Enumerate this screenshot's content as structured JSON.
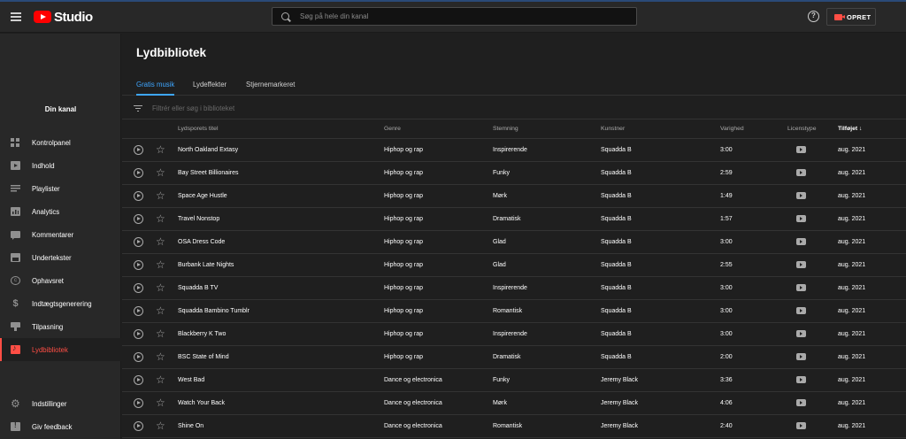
{
  "header": {
    "logo_text": "Studio",
    "search_placeholder": "Søg på hele din kanal",
    "help_symbol": "?",
    "create_label": "OPRET"
  },
  "sidebar": {
    "channel_label": "Din kanal",
    "items": [
      {
        "label": "Kontrolpanel",
        "icon": "dashboard-icon"
      },
      {
        "label": "Indhold",
        "icon": "content-icon"
      },
      {
        "label": "Playlister",
        "icon": "playlist-icon"
      },
      {
        "label": "Analytics",
        "icon": "analytics-icon"
      },
      {
        "label": "Kommentarer",
        "icon": "comments-icon"
      },
      {
        "label": "Undertekster",
        "icon": "subtitles-icon"
      },
      {
        "label": "Ophavsret",
        "icon": "copyright-icon"
      },
      {
        "label": "Indtægtsgenerering",
        "icon": "dollar-icon"
      },
      {
        "label": "Tilpasning",
        "icon": "customization-icon"
      },
      {
        "label": "Lydbibliotek",
        "icon": "audio-library-icon",
        "active": true
      }
    ],
    "bottom_items": [
      {
        "label": "Indstillinger",
        "icon": "settings-icon"
      },
      {
        "label": "Giv feedback",
        "icon": "feedback-icon"
      }
    ]
  },
  "main": {
    "title": "Lydbibliotek",
    "tabs": [
      {
        "label": "Gratis musik",
        "active": true
      },
      {
        "label": "Lydeffekter"
      },
      {
        "label": "Stjernemarkeret"
      }
    ],
    "filter_placeholder": "Filtrér eller søg i biblioteket",
    "columns": {
      "title": "Lydsporets titel",
      "genre": "Genre",
      "mood": "Stemning",
      "artist": "Kunstner",
      "duration": "Varighed",
      "license": "Licenstype",
      "added": "Tilføjet",
      "sort_arrow": "↓"
    },
    "rows": [
      {
        "title": "North Oakland Extasy",
        "genre": "Hiphop og rap",
        "mood": "Inspirerende",
        "artist": "Squadda B",
        "duration": "3:00",
        "added": "aug. 2021"
      },
      {
        "title": "Bay Street Billionaires",
        "genre": "Hiphop og rap",
        "mood": "Funky",
        "artist": "Squadda B",
        "duration": "2:59",
        "added": "aug. 2021"
      },
      {
        "title": "Space Age Hustle",
        "genre": "Hiphop og rap",
        "mood": "Mørk",
        "artist": "Squadda B",
        "duration": "1:49",
        "added": "aug. 2021"
      },
      {
        "title": "Travel Nonstop",
        "genre": "Hiphop og rap",
        "mood": "Dramatisk",
        "artist": "Squadda B",
        "duration": "1:57",
        "added": "aug. 2021"
      },
      {
        "title": "OSA Dress Code",
        "genre": "Hiphop og rap",
        "mood": "Glad",
        "artist": "Squadda B",
        "duration": "3:00",
        "added": "aug. 2021"
      },
      {
        "title": "Burbank Late Nights",
        "genre": "Hiphop og rap",
        "mood": "Glad",
        "artist": "Squadda B",
        "duration": "2:55",
        "added": "aug. 2021"
      },
      {
        "title": "Squadda B TV",
        "genre": "Hiphop og rap",
        "mood": "Inspirerende",
        "artist": "Squadda B",
        "duration": "3:00",
        "added": "aug. 2021"
      },
      {
        "title": "Squadda Bambino Tumblr",
        "genre": "Hiphop og rap",
        "mood": "Romantisk",
        "artist": "Squadda B",
        "duration": "3:00",
        "added": "aug. 2021"
      },
      {
        "title": "Blackberry K Two",
        "genre": "Hiphop og rap",
        "mood": "Inspirerende",
        "artist": "Squadda B",
        "duration": "3:00",
        "added": "aug. 2021"
      },
      {
        "title": "BSC State of Mind",
        "genre": "Hiphop og rap",
        "mood": "Dramatisk",
        "artist": "Squadda B",
        "duration": "2:00",
        "added": "aug. 2021"
      },
      {
        "title": "West Bad",
        "genre": "Dance og electronica",
        "mood": "Funky",
        "artist": "Jeremy Black",
        "duration": "3:36",
        "added": "aug. 2021"
      },
      {
        "title": "Watch Your Back",
        "genre": "Dance og electronica",
        "mood": "Mørk",
        "artist": "Jeremy Black",
        "duration": "4:06",
        "added": "aug. 2021"
      },
      {
        "title": "Shine On",
        "genre": "Dance og electronica",
        "mood": "Romantisk",
        "artist": "Jeremy Black",
        "duration": "2:40",
        "added": "aug. 2021"
      }
    ]
  },
  "colors": {
    "accent_red": "#ff4e45",
    "tab_blue": "#3ea6ff",
    "background": "#1f1f1f",
    "surface": "#282828"
  }
}
